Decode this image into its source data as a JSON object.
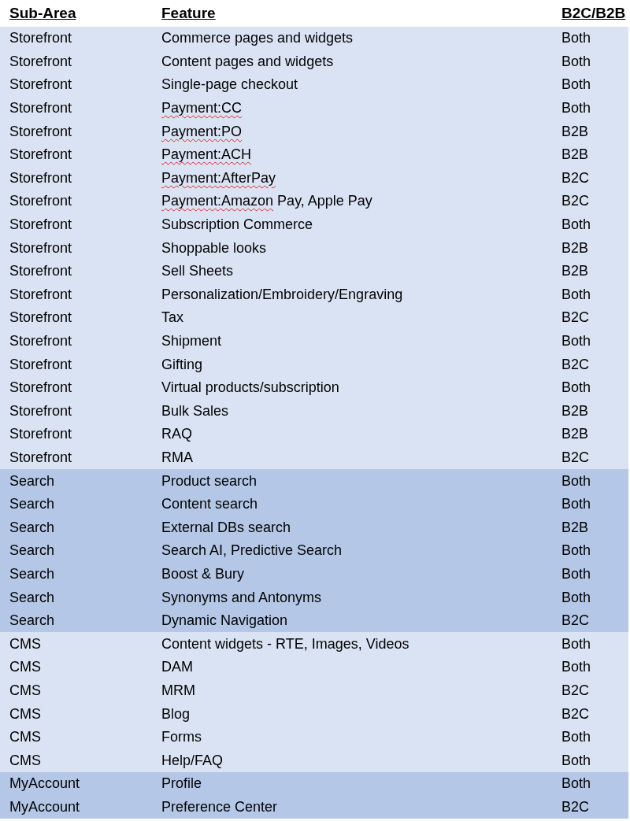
{
  "columns": [
    "Sub-Area",
    "Feature",
    "B2C/B2B"
  ],
  "groups": [
    {
      "color": "#dae3f3",
      "rows": [
        {
          "sub_area": "Storefront",
          "feature": [
            {
              "text": "Commerce pages and widgets",
              "misspelled": false
            }
          ],
          "channel": "Both"
        },
        {
          "sub_area": "Storefront",
          "feature": [
            {
              "text": "Content pages and widgets",
              "misspelled": false
            }
          ],
          "channel": "Both"
        },
        {
          "sub_area": "Storefront",
          "feature": [
            {
              "text": "Single-page checkout",
              "misspelled": false
            }
          ],
          "channel": "Both"
        },
        {
          "sub_area": "Storefront",
          "feature": [
            {
              "text": "Payment:CC",
              "misspelled": true
            }
          ],
          "channel": "Both"
        },
        {
          "sub_area": "Storefront",
          "feature": [
            {
              "text": "Payment:PO",
              "misspelled": true
            }
          ],
          "channel": "B2B"
        },
        {
          "sub_area": "Storefront",
          "feature": [
            {
              "text": "Payment:ACH",
              "misspelled": true
            }
          ],
          "channel": "B2B"
        },
        {
          "sub_area": "Storefront",
          "feature": [
            {
              "text": "Payment:AfterPay",
              "misspelled": true
            }
          ],
          "channel": "B2C"
        },
        {
          "sub_area": "Storefront",
          "feature": [
            {
              "text": "Payment:Amazon",
              "misspelled": true
            },
            {
              "text": "Pay, Apple Pay",
              "misspelled": false
            }
          ],
          "channel": "B2C"
        },
        {
          "sub_area": "Storefront",
          "feature": [
            {
              "text": "Subscription Commerce",
              "misspelled": false
            }
          ],
          "channel": "Both"
        },
        {
          "sub_area": "Storefront",
          "feature": [
            {
              "text": "Shoppable looks",
              "misspelled": false
            }
          ],
          "channel": "B2B"
        },
        {
          "sub_area": "Storefront",
          "feature": [
            {
              "text": "Sell Sheets",
              "misspelled": false
            }
          ],
          "channel": "B2B"
        },
        {
          "sub_area": "Storefront",
          "feature": [
            {
              "text": "Personalization/Embroidery/Engraving",
              "misspelled": false
            }
          ],
          "channel": "Both"
        },
        {
          "sub_area": "Storefront",
          "feature": [
            {
              "text": "Tax",
              "misspelled": false
            }
          ],
          "channel": "B2C"
        },
        {
          "sub_area": "Storefront",
          "feature": [
            {
              "text": "Shipment",
              "misspelled": false
            }
          ],
          "channel": "Both"
        },
        {
          "sub_area": "Storefront",
          "feature": [
            {
              "text": "Gifting",
              "misspelled": false
            }
          ],
          "channel": "B2C"
        },
        {
          "sub_area": "Storefront",
          "feature": [
            {
              "text": "Virtual products/subscription",
              "misspelled": false
            }
          ],
          "channel": "Both"
        },
        {
          "sub_area": "Storefront",
          "feature": [
            {
              "text": "Bulk Sales",
              "misspelled": false
            }
          ],
          "channel": "B2B"
        },
        {
          "sub_area": "Storefront",
          "feature": [
            {
              "text": "RAQ",
              "misspelled": false
            }
          ],
          "channel": "B2B"
        },
        {
          "sub_area": "Storefront",
          "feature": [
            {
              "text": "RMA",
              "misspelled": false
            }
          ],
          "channel": "B2C"
        }
      ]
    },
    {
      "color": "#b4c7e7",
      "rows": [
        {
          "sub_area": "Search",
          "feature": [
            {
              "text": "Product search",
              "misspelled": false
            }
          ],
          "channel": "Both"
        },
        {
          "sub_area": "Search",
          "feature": [
            {
              "text": "Content search",
              "misspelled": false
            }
          ],
          "channel": "Both"
        },
        {
          "sub_area": "Search",
          "feature": [
            {
              "text": "External DBs search",
              "misspelled": false
            }
          ],
          "channel": "B2B"
        },
        {
          "sub_area": "Search",
          "feature": [
            {
              "text": "Search AI, Predictive Search",
              "misspelled": false
            }
          ],
          "channel": "Both"
        },
        {
          "sub_area": "Search",
          "feature": [
            {
              "text": "Boost & Bury",
              "misspelled": false
            }
          ],
          "channel": "Both"
        },
        {
          "sub_area": "Search",
          "feature": [
            {
              "text": "Synonyms and Antonyms",
              "misspelled": false
            }
          ],
          "channel": "Both"
        },
        {
          "sub_area": "Search",
          "feature": [
            {
              "text": "Dynamic Navigation",
              "misspelled": false
            }
          ],
          "channel": "B2C"
        }
      ]
    },
    {
      "color": "#dae3f3",
      "rows": [
        {
          "sub_area": "CMS",
          "feature": [
            {
              "text": "Content widgets - RTE, Images, Videos",
              "misspelled": false
            }
          ],
          "channel": "Both"
        },
        {
          "sub_area": "CMS",
          "feature": [
            {
              "text": "DAM",
              "misspelled": false
            }
          ],
          "channel": "Both"
        },
        {
          "sub_area": "CMS",
          "feature": [
            {
              "text": "MRM",
              "misspelled": false
            }
          ],
          "channel": "B2C"
        },
        {
          "sub_area": "CMS",
          "feature": [
            {
              "text": "Blog",
              "misspelled": false
            }
          ],
          "channel": "B2C"
        },
        {
          "sub_area": "CMS",
          "feature": [
            {
              "text": "Forms",
              "misspelled": false
            }
          ],
          "channel": "Both"
        },
        {
          "sub_area": "CMS",
          "feature": [
            {
              "text": "Help/FAQ",
              "misspelled": false
            }
          ],
          "channel": "Both"
        }
      ]
    },
    {
      "color": "#b4c7e7",
      "rows": [
        {
          "sub_area": "MyAccount",
          "feature": [
            {
              "text": "Profile",
              "misspelled": false
            }
          ],
          "channel": "Both"
        },
        {
          "sub_area": "MyAccount",
          "feature": [
            {
              "text": "Preference Center",
              "misspelled": false
            }
          ],
          "channel": "B2C"
        }
      ]
    }
  ]
}
